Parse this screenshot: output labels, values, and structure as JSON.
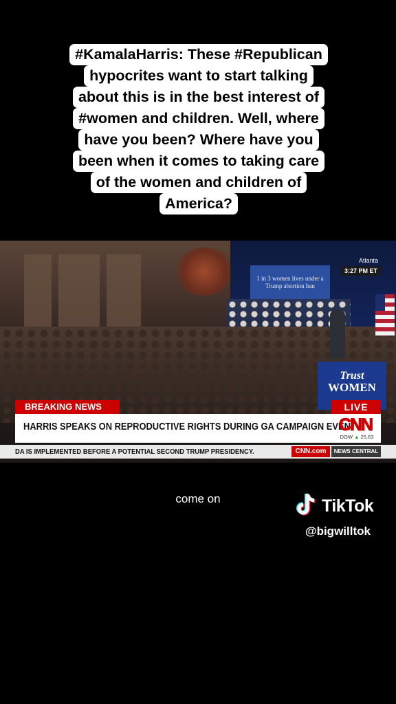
{
  "caption": {
    "lines": [
      "#KamalaHarris: These #Republican",
      "hypocrites want to start talking",
      "about this is in the best interest of",
      "#women and children. Well, where",
      "have you been? Where have you",
      "been when it comes to taking care",
      "of the women and children of",
      "America?"
    ]
  },
  "video": {
    "location": "Atlanta",
    "time": "3:27 PM ET",
    "screen_sign": "1 in 3 women lives under a Trump abortion ban",
    "podium_line1": "Trust",
    "podium_line2": "WOMEN",
    "breaking_label": "BREAKING NEWS",
    "live_label": "LIVE",
    "headline": "HARRIS SPEAKS ON REPRODUCTIVE RIGHTS DURING GA CAMPAIGN EVENT",
    "network_logo": "CNN",
    "dow_label": "DOW",
    "dow_change": "25.63",
    "ticker_text": "DA IS IMPLEMENTED BEFORE A POTENTIAL SECOND TRUMP PRESIDENCY.",
    "ticker_site": "CNN.com",
    "ticker_section": "NEWS CENTRAL"
  },
  "subtitle": "come on",
  "watermark": {
    "brand": "TikTok",
    "handle": "@bigwilltok"
  },
  "colors": {
    "cnn_red": "#cc0000",
    "background": "#000000",
    "caption_bg": "#ffffff"
  }
}
